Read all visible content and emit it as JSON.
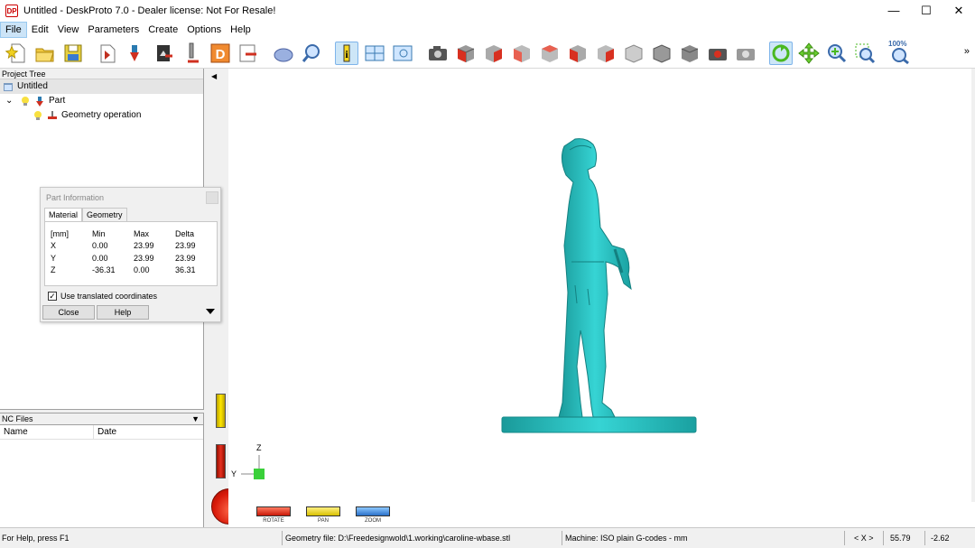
{
  "window": {
    "logo_text": "DP",
    "title": "Untitled - DeskProto 7.0 - Dealer license: Not For Resale!",
    "minimize": "—",
    "maximize": "☐",
    "close": "✕"
  },
  "menu": [
    "File",
    "Edit",
    "View",
    "Parameters",
    "Create",
    "Options",
    "Help"
  ],
  "toolbar": {
    "zoom_label": "100%",
    "more": "»"
  },
  "project_tree": {
    "header": "Project Tree",
    "items": [
      {
        "label": "Untitled",
        "selected": true
      },
      {
        "label": "Part",
        "expander": "⌄"
      },
      {
        "label": "Geometry operation"
      }
    ]
  },
  "nc_files": {
    "header": "NC Files",
    "columns": [
      "Name",
      "Date"
    ]
  },
  "part_info": {
    "title": "Part Information",
    "tabs": [
      "Material",
      "Geometry"
    ],
    "header": [
      "[mm]",
      "Min",
      "Max",
      "Delta"
    ],
    "rows": [
      [
        "X",
        "0.00",
        "23.99",
        "23.99"
      ],
      [
        "Y",
        "0.00",
        "23.99",
        "23.99"
      ],
      [
        "Z",
        "-36.31",
        "0.00",
        "36.31"
      ]
    ],
    "checkbox_label": "Use translated coordinates",
    "checkbox_checked": true,
    "close_button": "Close",
    "help_button": "Help"
  },
  "axes": {
    "z": "Z",
    "y": "Y"
  },
  "controls": {
    "rotate": "ROTATE",
    "pan": "PAN",
    "zoom": "ZOOM"
  },
  "statusbar": {
    "help": "For Help, press F1",
    "geometry_file": "Geometry file: D:\\Freedesignwold\\1.working\\caroline-wbase.stl",
    "machine": "Machine: ISO plain G-codes - mm",
    "nav": "< X >",
    "coord_x": "55.79",
    "coord_y": "-2.62"
  },
  "colors": {
    "model": "#2bc4c4",
    "rotate": "#e03010",
    "pan": "#e8d000",
    "zoom": "#3c8ee0"
  }
}
